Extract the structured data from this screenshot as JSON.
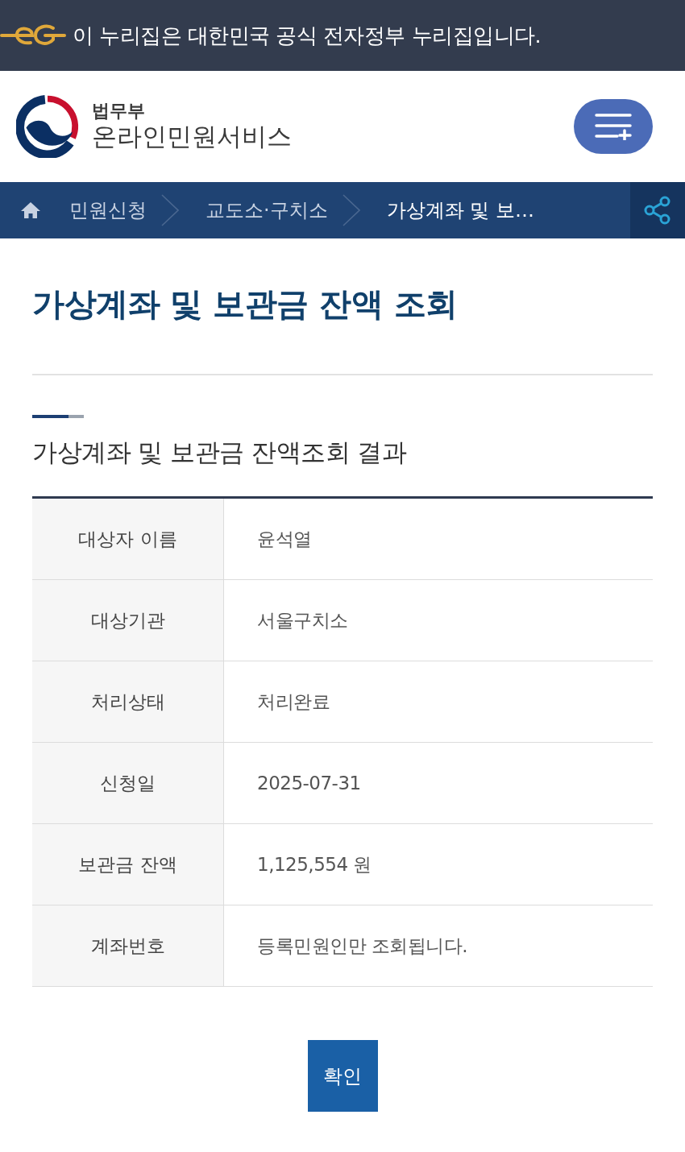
{
  "gov_banner": {
    "text": "이 누리집은 대한민국 공식 전자정부 누리집입니다."
  },
  "header": {
    "ministry": "법무부",
    "service": "온라인민원서비스"
  },
  "breadcrumb": [
    {
      "label": "민원신청",
      "current": false
    },
    {
      "label": "교도소·구치소",
      "current": false
    },
    {
      "label": "가상계좌 및 보…",
      "current": true
    }
  ],
  "page_title": "가상계좌 및 보관금 잔액 조회",
  "section_title": "가상계좌 및 보관금 잔액조회 결과",
  "table": {
    "rows": [
      {
        "label": "대상자 이름",
        "value": "윤석열"
      },
      {
        "label": "대상기관",
        "value": "서울구치소"
      },
      {
        "label": "처리상태",
        "value": "처리완료"
      },
      {
        "label": "신청일",
        "value": "2025-07-31"
      },
      {
        "label": "보관금 잔액",
        "value": "1,125,554 원"
      },
      {
        "label": "계좌번호",
        "value": "등록민원인만 조회됩니다."
      }
    ]
  },
  "buttons": [
    {
      "label": "확인"
    }
  ]
}
